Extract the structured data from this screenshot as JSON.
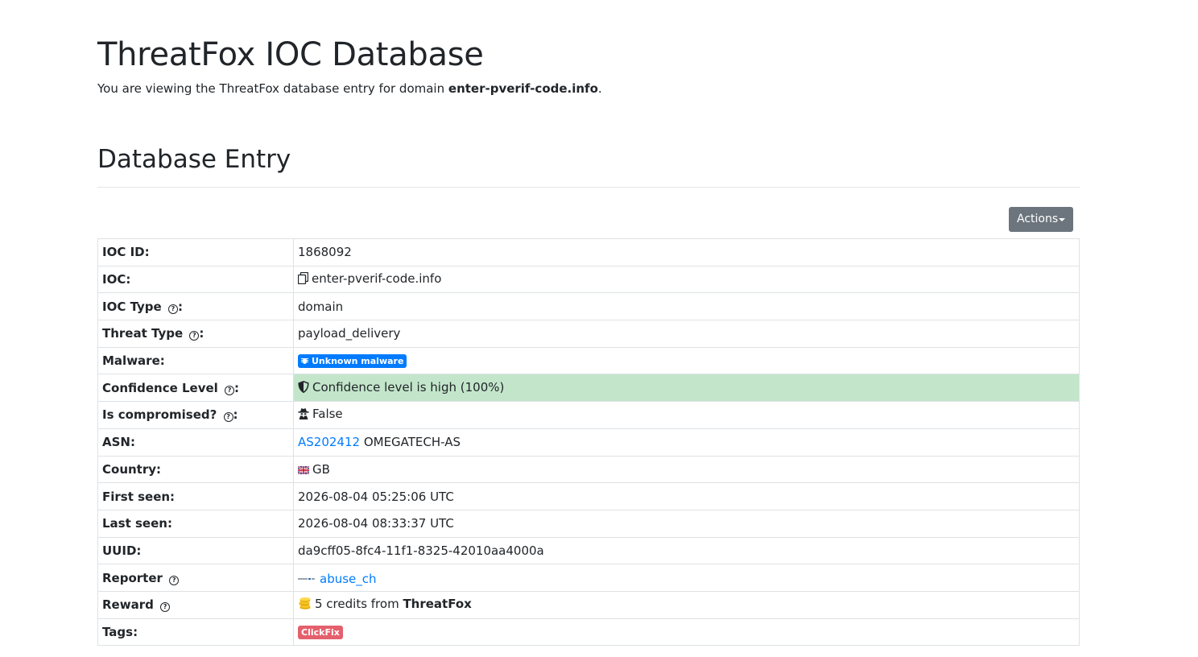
{
  "header": {
    "title": "ThreatFox IOC Database",
    "lead_prefix": "You are viewing the ThreatFox database entry for domain ",
    "lead_domain": "enter-pverif-code.info",
    "lead_suffix": "."
  },
  "section": {
    "title": "Database Entry"
  },
  "actions": {
    "label": "Actions"
  },
  "entry": {
    "ioc_id": {
      "label": "IOC ID:",
      "value": "1868092"
    },
    "ioc": {
      "label": "IOC:",
      "value": "enter-pverif-code.info",
      "icon": "copy-icon"
    },
    "ioc_type": {
      "label_a": "IOC Type",
      "label_b": ":",
      "value": "domain",
      "help": "?"
    },
    "threat_type": {
      "label_a": "Threat Type",
      "label_b": ":",
      "value": "payload_delivery",
      "help": "?"
    },
    "malware": {
      "label": "Malware:",
      "value": "Unknown malware",
      "icon": "bug-icon",
      "color": "#007bff"
    },
    "confidence": {
      "label_a": "Confidence Level",
      "label_b": ":",
      "value": "Confidence level is high (100%)",
      "help": "?",
      "icon": "shield-icon",
      "color": "#c3e6cb"
    },
    "compromised": {
      "label_a": "Is compromised?",
      "label_b": ":",
      "value": "False",
      "help": "?",
      "icon": "spy-icon"
    },
    "asn": {
      "label": "ASN:",
      "link": "AS202412",
      "name": " OMEGATECH-AS",
      "link_color": "#007bff"
    },
    "country": {
      "label": "Country:",
      "value": "GB",
      "icon": "uk-flag-icon"
    },
    "first_seen": {
      "label": "First seen:",
      "value": "2026-08-04 05:25:06 UTC"
    },
    "last_seen": {
      "label": "Last seen:",
      "value": "2026-08-04 08:33:37 UTC"
    },
    "uuid": {
      "label": "UUID:",
      "value": "da9cff05-8fc4-11f1-8325-42010aa4000a"
    },
    "reporter": {
      "label": "Reporter",
      "help": "?",
      "value": "abuse_ch",
      "icon": "abusech-logo"
    },
    "reward": {
      "label": "Reward",
      "help": "?",
      "prefix": "5 credits from ",
      "source": "ThreatFox",
      "icon": "coins-icon"
    },
    "tags": {
      "label": "Tags:",
      "value": "ClickFix",
      "color": "#e4606d"
    }
  }
}
